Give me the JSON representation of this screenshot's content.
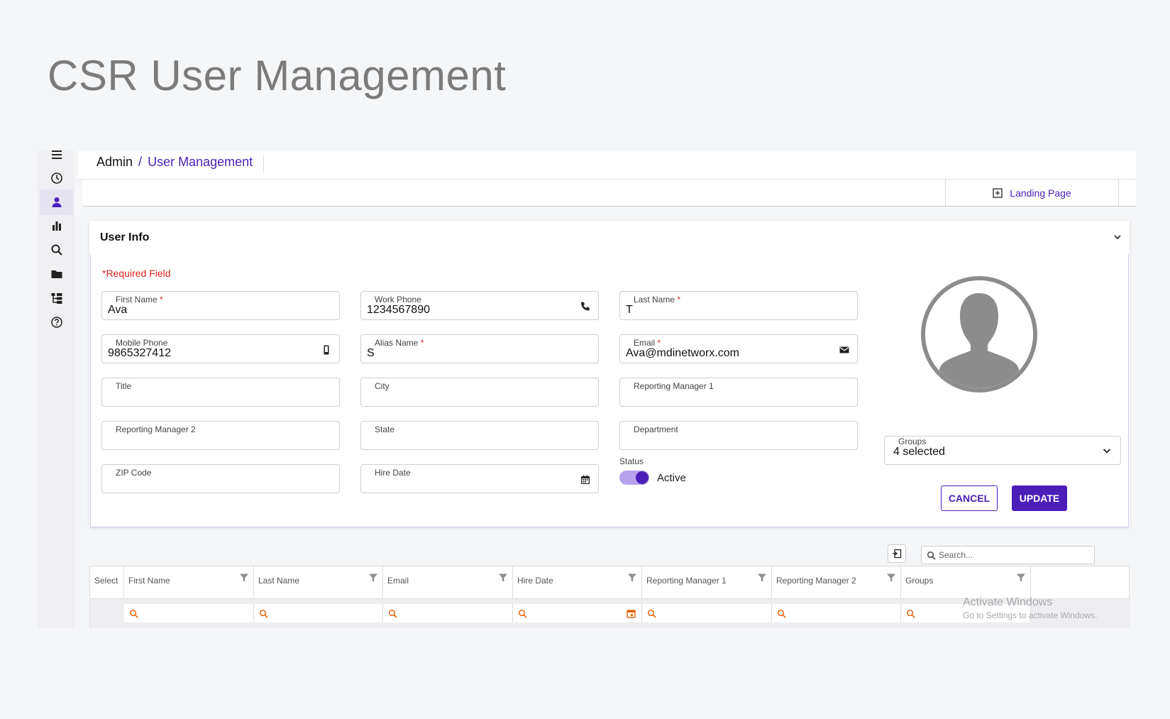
{
  "page": {
    "heading": "CSR User Management"
  },
  "sidebar": {
    "items": [
      {
        "name": "menu-icon"
      },
      {
        "name": "history-icon"
      },
      {
        "name": "user-icon",
        "active": true
      },
      {
        "name": "bar-chart-icon"
      },
      {
        "name": "search-icon"
      },
      {
        "name": "folder-icon"
      },
      {
        "name": "hierarchy-icon"
      },
      {
        "name": "help-icon"
      }
    ]
  },
  "breadcrumb": {
    "root": "Admin",
    "separator": "/",
    "current": "User Management"
  },
  "tabs": {
    "landing": "Landing Page"
  },
  "user_info": {
    "title": "User Info",
    "required_note": "*Required Field",
    "fields": {
      "first_name": {
        "label": "First Name",
        "required": "*",
        "value": "Ava"
      },
      "work_phone": {
        "label": "Work Phone",
        "value": "1234567890"
      },
      "last_name": {
        "label": "Last Name",
        "required": "*",
        "value": "T"
      },
      "mobile_phone": {
        "label": "Mobile Phone",
        "value": "9865327412"
      },
      "alias_name": {
        "label": "Alias Name",
        "required": "*",
        "value": "S"
      },
      "email": {
        "label": "Email",
        "required": "*",
        "value": "Ava@mdinetworx.com"
      },
      "title": {
        "label": "Title",
        "value": ""
      },
      "city": {
        "label": "City",
        "value": ""
      },
      "reporting_manager_1": {
        "label": "Reporting Manager 1",
        "value": ""
      },
      "reporting_manager_2": {
        "label": "Reporting Manager 2",
        "value": ""
      },
      "state": {
        "label": "State",
        "value": ""
      },
      "department": {
        "label": "Department",
        "value": ""
      },
      "zip_code": {
        "label": "ZIP Code",
        "value": ""
      },
      "hire_date": {
        "label": "Hire Date",
        "value": ""
      }
    },
    "status": {
      "label": "Status",
      "value": "Active",
      "on": true
    },
    "groups": {
      "label": "Groups",
      "value": "4 selected"
    },
    "cancel_label": "CANCEL",
    "update_label": "UPDATE"
  },
  "grid": {
    "search_placeholder": "Search...",
    "columns": [
      "Select",
      "First Name",
      "Last Name",
      "Email",
      "Hire Date",
      "Reporting Manager 1",
      "Reporting Manager 2",
      "Groups"
    ]
  },
  "watermark": {
    "line1": "Activate Windows",
    "line2": "Go to Settings to activate Windows."
  },
  "colors": {
    "accent": "#4a1fb8",
    "required": "#e02020",
    "filter_icon": "#e8640c"
  }
}
